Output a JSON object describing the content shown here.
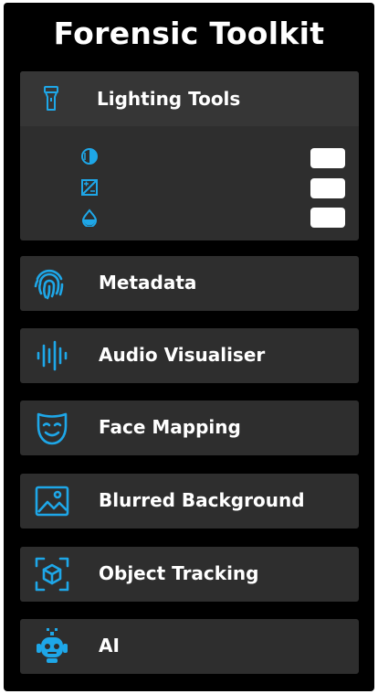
{
  "app": {
    "title": "Forensic Toolkit"
  },
  "accent_color": "#1ea7e8",
  "lighting": {
    "label": "Lighting Tools",
    "icon": "flashlight-icon",
    "controls": [
      {
        "icon": "contrast-icon"
      },
      {
        "icon": "exposure-icon"
      },
      {
        "icon": "water-drop-icon"
      }
    ]
  },
  "tools": [
    {
      "label": "Metadata",
      "icon": "fingerprint-icon"
    },
    {
      "label": "Audio Visualiser",
      "icon": "audio-waveform-icon"
    },
    {
      "label": "Face Mapping",
      "icon": "face-mask-icon"
    },
    {
      "label": "Blurred Background",
      "icon": "image-icon"
    },
    {
      "label": "Object Tracking",
      "icon": "object-tracking-icon"
    },
    {
      "label": "AI",
      "icon": "robot-icon"
    }
  ]
}
